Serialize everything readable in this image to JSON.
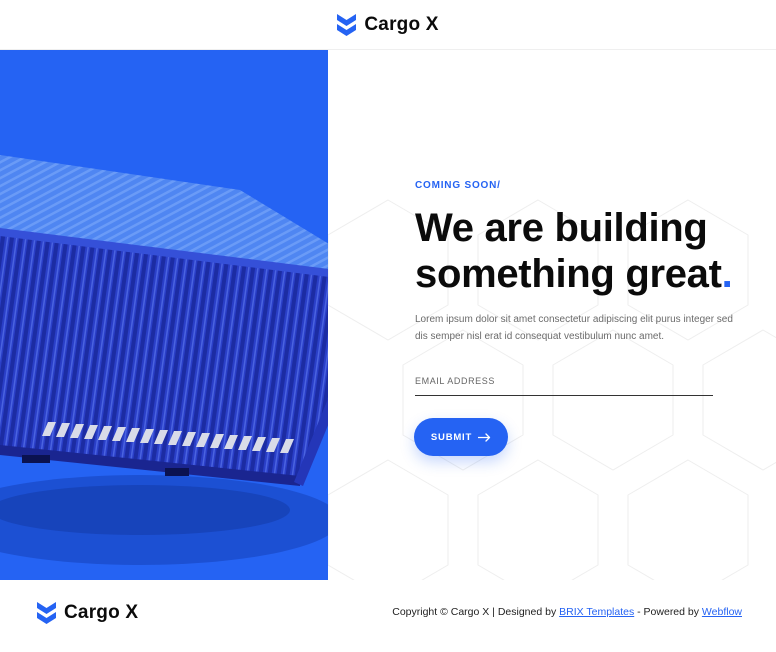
{
  "header": {
    "brand_name": "Cargo X",
    "logo_icon": "chevron-logo-icon"
  },
  "hero": {
    "eyebrow": "COMING SOON/",
    "headline_line1": "We are building",
    "headline_line2": "something great",
    "headline_dot": ".",
    "description": "Lorem ipsum dolor sit amet consectetur adipiscing elit purus integer sed dis semper nisl erat id consequat vestibulum nunc amet.",
    "email_placeholder": "EMAIL ADDRESS",
    "submit_label": "SUBMIT",
    "submit_icon": "arrow-right-icon",
    "image_subject": "shipping-container-image"
  },
  "footer": {
    "brand_name": "Cargo X",
    "copyright_prefix": "Copyright © Cargo X | Designed by ",
    "designer_link": "BRIX Templates",
    "powered_prefix": " - Powered by ",
    "platform_link": "Webflow"
  },
  "colors": {
    "accent": "#2563f3",
    "text": "#0b0b0b",
    "muted": "#6b6b6b"
  }
}
